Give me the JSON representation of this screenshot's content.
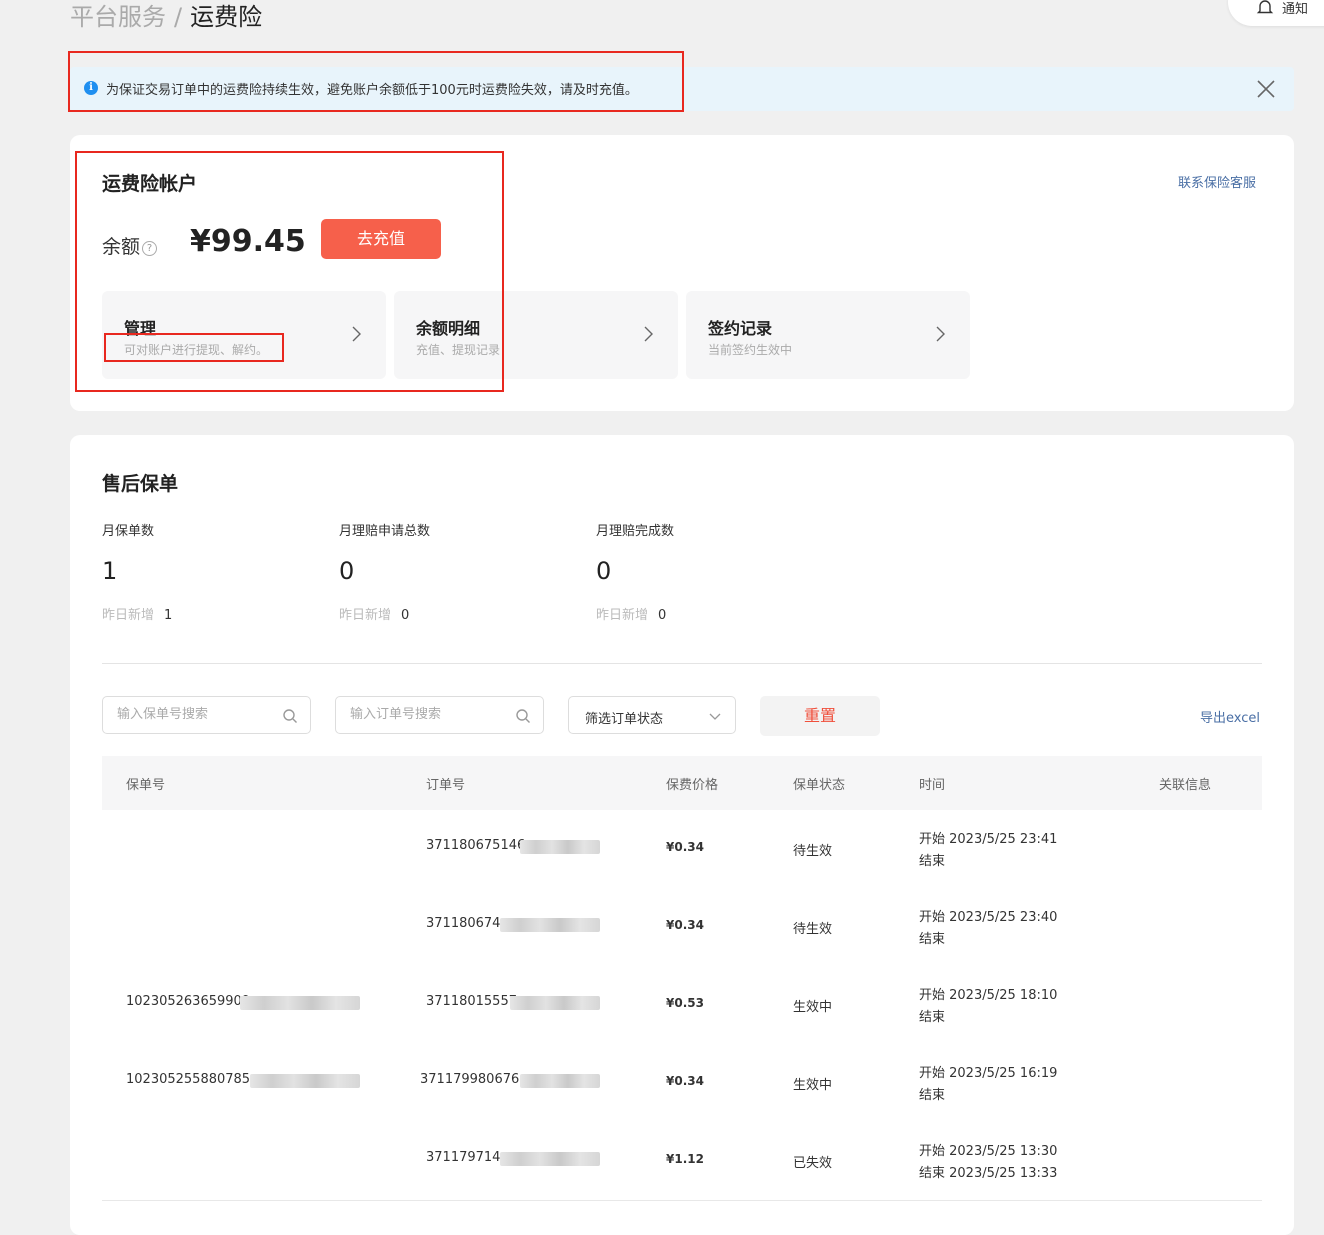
{
  "breadcrumb": {
    "parent": "平台服务",
    "separator": "/",
    "current": "运费险"
  },
  "notification": {
    "label": "通知"
  },
  "alert": {
    "text": "为保证交易订单中的运费险持续生效，避免账户余额低于100元时运费险失效，请及时充值。"
  },
  "account": {
    "title": "运费险帐户",
    "contact_link": "联系保险客服",
    "balance_label": "余额",
    "balance_help": "?",
    "balance_value": "¥99.45",
    "recharge_button": "去充值",
    "tiles": [
      {
        "title": "管理",
        "subtitle": "可对账户进行提现、解约。"
      },
      {
        "title": "余额明细",
        "subtitle": "充值、提现记录"
      },
      {
        "title": "签约记录",
        "subtitle": "当前签约生效中"
      }
    ]
  },
  "after_sales": {
    "title": "售后保单",
    "stats": [
      {
        "label": "月保单数",
        "value": "1",
        "sub_label": "昨日新增",
        "sub_value": "1"
      },
      {
        "label": "月理赔申请总数",
        "value": "0",
        "sub_label": "昨日新增",
        "sub_value": "0"
      },
      {
        "label": "月理赔完成数",
        "value": "0",
        "sub_label": "昨日新增",
        "sub_value": "0"
      }
    ],
    "filters": {
      "policy_search_placeholder": "输入保单号搜索",
      "order_search_placeholder": "输入订单号搜索",
      "status_select": "筛选订单状态",
      "reset_button": "重置",
      "export_link": "导出excel"
    },
    "table": {
      "headers": [
        "保单号",
        "订单号",
        "保费价格",
        "保单状态",
        "时间",
        "关联信息"
      ],
      "rows": [
        {
          "policy": "",
          "order": "371180675146",
          "price": "¥0.34",
          "status": "待生效",
          "start": "开始 2023/5/25 23:41",
          "end": "结束"
        },
        {
          "policy": "",
          "order": "371180674",
          "price": "¥0.34",
          "status": "待生效",
          "start": "开始 2023/5/25 23:40",
          "end": "结束"
        },
        {
          "policy": "102305263659909",
          "order": "37118015557",
          "price": "¥0.53",
          "status": "生效中",
          "start": "开始 2023/5/25 18:10",
          "end": "结束"
        },
        {
          "policy": "102305255880785",
          "order": "371179980676",
          "price": "¥0.34",
          "status": "生效中",
          "start": "开始 2023/5/25 16:19",
          "end": "结束"
        },
        {
          "policy": "",
          "order": "371179714",
          "price": "¥1.12",
          "status": "已失效",
          "start": "开始 2023/5/25 13:30",
          "end": "结束 2023/5/25 13:33"
        }
      ]
    }
  }
}
